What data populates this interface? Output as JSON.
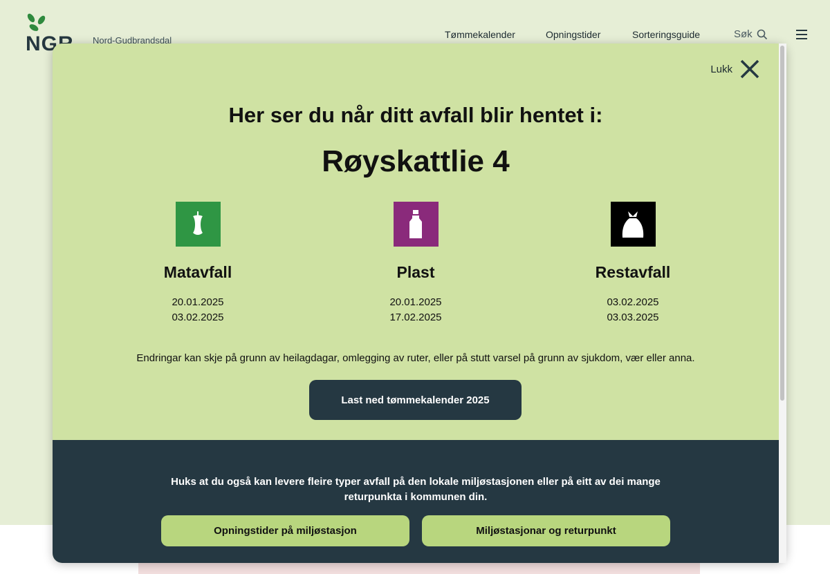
{
  "brand": {
    "logo_text": "NGR",
    "subtitle": "Nord-Gudbrandsdal"
  },
  "nav": {
    "items": [
      "Tømmekalender",
      "Opningstider",
      "Sorteringsguide"
    ],
    "search_label": "Søk"
  },
  "modal": {
    "close_label": "Lukk",
    "heading": "Her ser du når ditt avfall blir hentet i:",
    "address": "Røyskattlie 4",
    "categories": [
      {
        "title": "Matavfall",
        "icon": "apple-core-icon",
        "color": "#2f9644",
        "dates": [
          "20.01.2025",
          "03.02.2025"
        ]
      },
      {
        "title": "Plast",
        "icon": "plastic-bottle-icon",
        "color": "#8a2a7b",
        "dates": [
          "20.01.2025",
          "17.02.2025"
        ]
      },
      {
        "title": "Restavfall",
        "icon": "trash-bag-icon",
        "color": "#000000",
        "dates": [
          "03.02.2025",
          "03.03.2025"
        ]
      }
    ],
    "notice": "Endringar kan skje på grunn av heilagdagar, omlegging av ruter, eller på stutt varsel på grunn av sjukdom, vær eller anna.",
    "download_button": "Last ned tømmekalender 2025",
    "footer": {
      "text": "Huks at du også kan levere fleire typer avfall på den lokale miljøstasjonen eller på eitt av dei mange returpunkta i kommunen din.",
      "button_left": "Opningstider på miljøstasjon",
      "button_right": "Miljøstasjonar og returpunkt"
    }
  },
  "colors": {
    "page_bg": "#e6eed6",
    "modal_bg": "#cfe2a3",
    "dark": "#253842",
    "button_green": "#b8d67e"
  }
}
